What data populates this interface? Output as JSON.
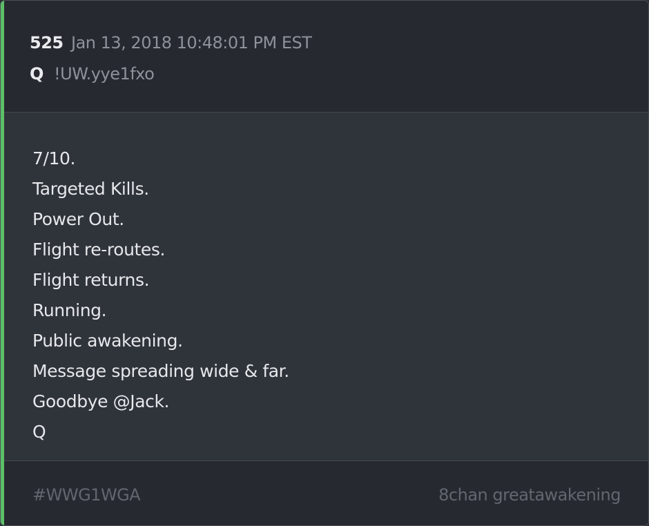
{
  "post": {
    "number": "525",
    "date": "Jan 13, 2018 10:48:01 PM EST",
    "author": "Q",
    "tripcode": "!UW.yye1fxo",
    "lines": [
      "7/10.",
      "Targeted Kills.",
      "Power Out.",
      "Flight re-routes.",
      "Flight returns.",
      "Running.",
      "Public awakening.",
      "Message spreading wide & far.",
      "Goodbye @Jack.",
      "Q"
    ],
    "hashtag": "#WWG1WGA",
    "source": "8chan greatawakening"
  },
  "colors": {
    "accent": "#5cbf68",
    "header_bg": "#26292f",
    "body_bg": "#2f333a",
    "text": "#e6e8eb",
    "muted": "#8d929b",
    "footer_text": "#62676f"
  }
}
